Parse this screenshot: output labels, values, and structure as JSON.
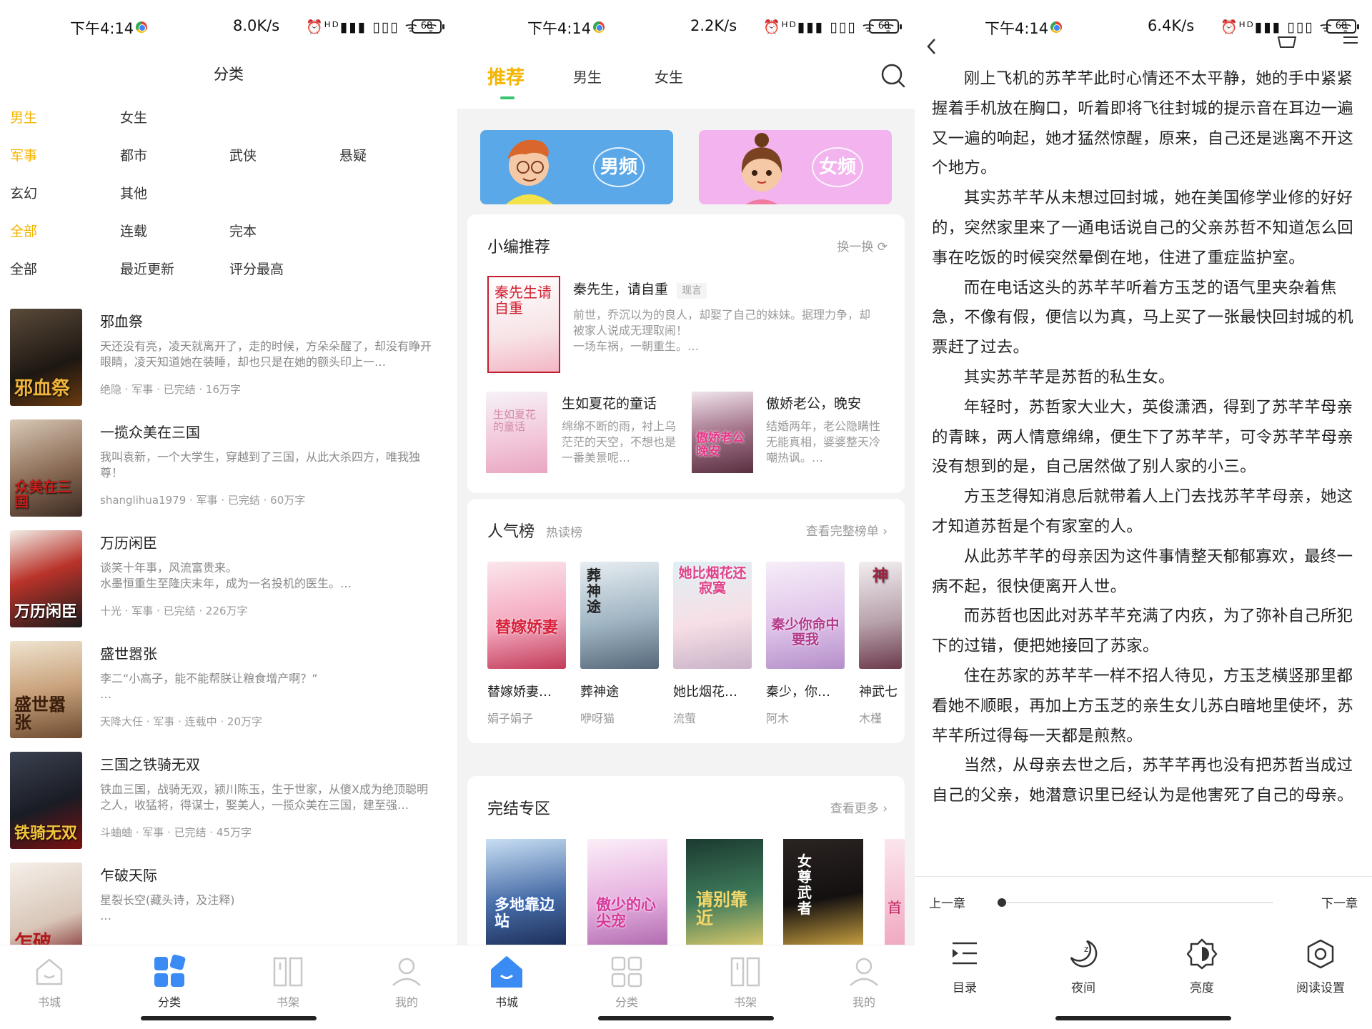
{
  "status_bars": [
    {
      "time": "下午4:14",
      "speed": "8.0K/s",
      "icons": "⏰ᴴᴰ▮▮▮ ▯▯▯ ᯤ ᯤ",
      "battery": "68"
    },
    {
      "time": "下午4:14",
      "speed": "2.2K/s",
      "icons": "⏰ᴴᴰ▮▮▮ ▯▯▯ ᯤ ᯤ",
      "battery": "68"
    },
    {
      "time": "下午4:14",
      "speed": "6.4K/s",
      "icons": "⏰ᴴᴰ▮▮▮ ▯▯▯ ᯤ ᯤ",
      "battery": "68"
    }
  ],
  "category": {
    "title": "分类",
    "filters": [
      [
        "男生",
        "女生"
      ],
      [
        "军事",
        "都市",
        "武侠",
        "悬疑"
      ],
      [
        "玄幻",
        "其他"
      ],
      [
        "全部",
        "连载",
        "完本"
      ],
      [
        "全部",
        "最近更新",
        "评分最高"
      ]
    ],
    "books": [
      {
        "name": "邪血祭",
        "desc": "天还没有亮，凌天就离开了，走的时候，方朵朵醒了，却没有睁开眼睛，凌天知道她在装睡，却也只是在她的额头印上一…",
        "meta": "绝隐 · 军事 · 已完结 · 16万字",
        "cover_text": "邪血祭"
      },
      {
        "name": "一揽众美在三国",
        "desc": "我叫袁新，一个大学生，穿越到了三国，从此大杀四方，唯我独尊！",
        "meta": "shanglihua1979 · 军事 · 已完结 · 60万字",
        "cover_text": "众美在三国"
      },
      {
        "name": "万历闲臣",
        "desc": "谈笑十年事，风流富贵来。\n水墨恒重生至隆庆末年，成为一名投机的医生。…",
        "meta": "十光 · 军事 · 已完结 · 226万字",
        "cover_text": "万历闲臣"
      },
      {
        "name": "盛世嚣张",
        "desc": "李二“小高子，能不能帮朕让粮食增产啊？”\n…",
        "meta": "天降大任 · 军事 · 连载中 · 20万字",
        "cover_text": "盛世嚣张"
      },
      {
        "name": "三国之铁骑无双",
        "desc": "铁血三国，战骑无双，颍川陈玉，生于世家，从傻X成为绝顶聪明之人，收猛将，得谋士，娶美人，一揽众美在三国，建至强…",
        "meta": "斗蛐蛐 · 军事 · 已完结 · 45万字",
        "cover_text": "铁骑无双"
      },
      {
        "name": "乍破天际",
        "desc": "星裂长空(藏头诗，及注释)\n…",
        "meta": "",
        "cover_text": "乍破"
      }
    ]
  },
  "nav": {
    "items": [
      "书城",
      "分类",
      "书架",
      "我的"
    ]
  },
  "store": {
    "tabs": [
      "推荐",
      "男生",
      "女生"
    ],
    "banners": [
      "男频",
      "女频"
    ],
    "editor": {
      "title": "小编推荐",
      "action": "换一换",
      "main": {
        "name": "秦先生，请自重",
        "tag": "现言",
        "desc": "前世，乔沉以为的良人，却娶了自己的妹妹。据理力争，却被家人说成无理取闹！\n一场车祸，一朝重生。…",
        "cover_text": "秦先生请自重"
      },
      "subs": [
        {
          "name": "生如夏花的童话",
          "desc": "绵绵不断的雨，衬上乌茫茫的天空，不想也是一番美景呢…",
          "cover_text": "生如夏花的童话"
        },
        {
          "name": "傲娇老公，晚安",
          "desc": "结婚两年，老公隐瞒性无能真相，婆婆整天冷嘲热讽。…",
          "cover_text": "傲娇老公晚安"
        }
      ]
    },
    "rank": {
      "title": "人气榜",
      "sub": "热读榜",
      "action": "查看完整榜单",
      "items": [
        {
          "name": "替嫁娇妻…",
          "author": "娟子娟子",
          "cover_text": "替嫁娇妻"
        },
        {
          "name": "葬神途",
          "author": "咿呀猫",
          "cover_text": "葬神途"
        },
        {
          "name": "她比烟花…",
          "author": "流萤",
          "cover_text": "她比烟花还寂寞"
        },
        {
          "name": "秦少，你…",
          "author": "阿木",
          "cover_text": "秦少你命中要我"
        },
        {
          "name": "神武七",
          "author": "木槿",
          "cover_text": "神"
        }
      ]
    },
    "finished": {
      "title": "完结专区",
      "action": "查看更多",
      "covers": [
        "多地靠边站",
        "傲少的心尖宠",
        "请别靠近",
        "女尊武者",
        "首"
      ]
    }
  },
  "reader": {
    "paragraphs": [
      "刚上飞机的苏芊芊此时心情还不太平静，她的手中紧紧握着手机放在胸口，听着即将飞往封城的提示音在耳边一遍又一遍的响起，她才猛然惊醒，原来，自己还是逃离不开这个地方。",
      "其实苏芊芊从未想过回封城，她在美国修学业修的好好的，突然家里来了一通电话说自己的父亲苏哲不知道怎么回事在吃饭的时候突然晕倒在地，住进了重症监护室。",
      "而在电话这头的苏芊芊听着方玉芝的语气里夹杂着焦急，不像有假，便信以为真，马上买了一张最快回封城的机票赶了过去。",
      "其实苏芊芊是苏哲的私生女。",
      "年轻时，苏哲家大业大，英俊潇洒，得到了苏芊芊母亲的青睐，两人情意绵绵，便生下了苏芊芊，可令苏芊芊母亲没有想到的是，自己居然做了别人家的小三。",
      "方玉芝得知消息后就带着人上门去找苏芊芊母亲，她这才知道苏哲是个有家室的人。",
      "从此苏芊芊的母亲因为这件事情整天郁郁寡欢，最终一病不起，很快便离开人世。",
      "而苏哲也因此对苏芊芊充满了内疚，为了弥补自己所犯下的过错，便把她接回了苏家。",
      "住在苏家的苏芊芊一样不招人待见，方玉芝横竖那里都看她不顺眼，再加上方玉芝的亲生女儿苏白暗地里使坏，苏芊芊所过得每一天都是煎熬。",
      "当然，从母亲去世之后，苏芊芊再也没有把苏哲当成过自己的父亲，她潜意识里已经认为是他害死了自己的母亲。"
    ],
    "prev": "上一章",
    "next": "下一章",
    "progress": 0,
    "tools": [
      "目录",
      "夜间",
      "亮度",
      "阅读设置"
    ]
  },
  "colors": {
    "accent": "#f5b400",
    "nav_active": "#3b8bf5",
    "indicator": "#37c56d"
  }
}
